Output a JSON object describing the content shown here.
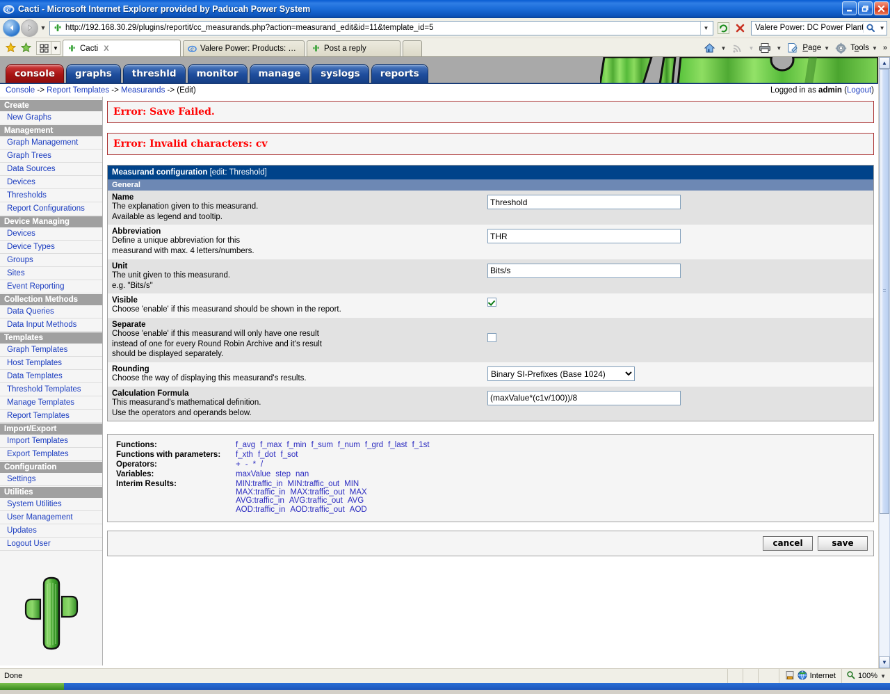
{
  "window": {
    "title": "Cacti - Microsoft Internet Explorer provided by Paducah Power System",
    "minimize_label": "Minimize",
    "restore_label": "Restore",
    "close_label": "Close"
  },
  "browser": {
    "back_label": "Back",
    "forward_label": "Forward",
    "recent_pages_caret": "▼",
    "url": "http://192.168.30.29/plugins/reportit/cc_measurands.php?action=measurand_edit&id=11&template_id=5",
    "url_caret": "▼",
    "refresh_label": "Refresh",
    "stop_label": "Stop",
    "search_value": "Valere Power: DC Power Plant",
    "search_caret": "▼",
    "tabs": [
      {
        "label": "Cacti",
        "icon": "cactus-icon",
        "active": true,
        "close": "X"
      },
      {
        "label": "Valere Power: Products: Com...",
        "icon": "ie-icon",
        "active": false,
        "close": ""
      },
      {
        "label": "Post a reply",
        "icon": "cactus-icon",
        "active": false,
        "close": ""
      },
      {
        "label": "",
        "icon": "new-tab-icon",
        "active": false,
        "close": ""
      }
    ],
    "commands": {
      "home": "Home",
      "feeds": "Feeds",
      "print": "Print",
      "page": "Page",
      "tools": "Tools",
      "overflow": "»",
      "caret": "▼"
    }
  },
  "cacti": {
    "nav_tabs": [
      {
        "label": "console",
        "active": true
      },
      {
        "label": "graphs",
        "active": false
      },
      {
        "label": "threshld",
        "active": false
      },
      {
        "label": "monitor",
        "active": false
      },
      {
        "label": "manage",
        "active": false
      },
      {
        "label": "syslogs",
        "active": false
      },
      {
        "label": "reports",
        "active": false
      }
    ],
    "breadcrumb": [
      {
        "label": "Console",
        "link": true
      },
      {
        "label": "Report Templates",
        "link": true
      },
      {
        "label": "Measurands",
        "link": true
      },
      {
        "label": "(Edit)",
        "link": false
      }
    ],
    "breadcrumb_sep": "->",
    "login_prefix": "Logged in as",
    "login_user": "admin",
    "logout_open": "(",
    "logout_label": "Logout",
    "logout_close": ")"
  },
  "sidebar": {
    "sections": [
      {
        "head": "Create",
        "items": [
          "New Graphs"
        ]
      },
      {
        "head": "Management",
        "items": [
          "Graph Management",
          "Graph Trees",
          "Data Sources",
          "Devices",
          "Thresholds",
          "Report Configurations"
        ]
      },
      {
        "head": "Device Managing",
        "items": [
          "Devices",
          "Device Types",
          "Groups",
          "Sites",
          "Event Reporting"
        ]
      },
      {
        "head": "Collection Methods",
        "items": [
          "Data Queries",
          "Data Input Methods"
        ]
      },
      {
        "head": "Templates",
        "items": [
          "Graph Templates",
          "Host Templates",
          "Data Templates",
          "Threshold Templates",
          "Manage Templates",
          "Report Templates"
        ]
      },
      {
        "head": "Import/Export",
        "items": [
          "Import Templates",
          "Export Templates"
        ]
      },
      {
        "head": "Configuration",
        "items": [
          "Settings"
        ]
      },
      {
        "head": "Utilities",
        "items": [
          "System Utilities",
          "User Management",
          "Updates",
          "Logout User"
        ]
      }
    ]
  },
  "errors": [
    "Error: Save Failed.",
    "Error: Invalid characters: cv"
  ],
  "form": {
    "title_bold": "Measurand configuration",
    "title_light": "[edit: Threshold]",
    "section": "General",
    "fields": [
      {
        "name": "Name",
        "desc": "The explanation given to this measurand.\nAvailable as legend and tooltip.",
        "type": "text",
        "value": "Threshold"
      },
      {
        "name": "Abbreviation",
        "desc": "Define a unique abbreviation for this\nmeasurand with max. 4 letters/numbers.",
        "type": "text",
        "value": "THR"
      },
      {
        "name": "Unit",
        "desc": "The unit given to this measurand.\ne.g. \"Bits/s\"",
        "type": "text",
        "value": "Bits/s"
      },
      {
        "name": "Visible",
        "desc": "Choose 'enable' if this measurand should be shown in the report.",
        "type": "checkbox",
        "value": true
      },
      {
        "name": "Separate",
        "desc": "Choose 'enable' if this measurand will only have one result\ninstead of one for every Round Robin Archive and it's result\nshould be displayed separately.",
        "type": "checkbox",
        "value": false
      },
      {
        "name": "Rounding",
        "desc": "Choose the way of displaying this measurand's results.",
        "type": "select",
        "value": "Binary SI-Prefixes (Base 1024)",
        "options": [
          "Binary SI-Prefixes (Base 1024)"
        ]
      },
      {
        "name": "Calculation Formula",
        "desc": "This measurand's mathematical definition.\nUse the operators and operands below.",
        "type": "text",
        "value": "(maxValue*(c1v/100))/8"
      }
    ]
  },
  "helper": {
    "rows": [
      {
        "label": "Functions:",
        "values": [
          [
            "f_avg",
            "f_max",
            "f_min",
            "f_sum",
            "f_num",
            "f_grd",
            "f_last",
            "f_1st"
          ]
        ]
      },
      {
        "label": "Functions with parameters:",
        "values": [
          [
            "f_xth",
            "f_dot",
            "f_sot"
          ]
        ]
      },
      {
        "label": "Operators:",
        "values": [
          [
            "+",
            "-",
            "*",
            "/"
          ]
        ]
      },
      {
        "label": "Variables:",
        "values": [
          [
            "maxValue",
            "step",
            "nan"
          ]
        ]
      },
      {
        "label": "Interim Results:",
        "values": [
          [
            "MIN:traffic_in",
            "MIN:traffic_out",
            "MIN"
          ],
          [
            "MAX:traffic_in",
            "MAX:traffic_out",
            "MAX"
          ],
          [
            "AVG:traffic_in",
            "AVG:traffic_out",
            "AVG"
          ],
          [
            "AOD:traffic_in",
            "AOD:traffic_out",
            "AOD"
          ]
        ]
      }
    ]
  },
  "actions": {
    "cancel_label": "cancel",
    "save_label": "save"
  },
  "statusbar": {
    "message": "Done",
    "zone": "Internet",
    "zoom": "100%",
    "zoom_caret": "▼"
  },
  "colors": {
    "error_text": "#ff0000",
    "error_border": "#ab3232",
    "form_header": "#00438a",
    "form_subheader": "#6d88b4",
    "link": "#1a3cc0",
    "active_tab": "#a81414",
    "tab": "#1e4d9c",
    "menu_head": "#a0a0a0"
  }
}
